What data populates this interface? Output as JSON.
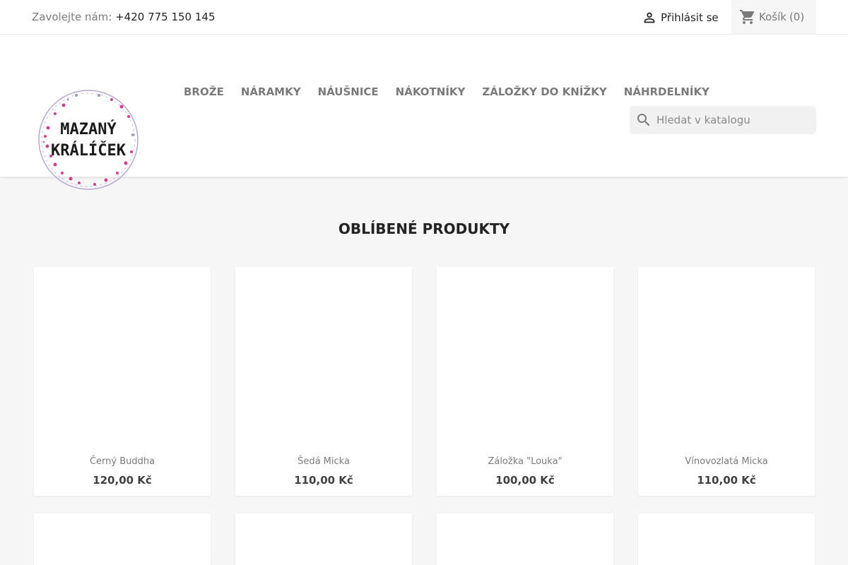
{
  "topbar": {
    "contact_label": "Zavolejte nám:",
    "phone": "+420 775 150 145",
    "signin_label": "Přihlásit se",
    "cart_label": "Košík",
    "cart_count": "(0)"
  },
  "logo": {
    "line1": "MAZANÝ",
    "line2": "KRÁLÍČEK"
  },
  "nav": {
    "items": [
      {
        "label": "BROŽE"
      },
      {
        "label": "NÁRAMKY"
      },
      {
        "label": "NÁUŠNICE"
      },
      {
        "label": "NÁKOTNÍKY"
      },
      {
        "label": "ZÁLOŽKY DO KNÍŽKY"
      },
      {
        "label": "NÁHRDELNÍKY"
      }
    ]
  },
  "search": {
    "placeholder": "Hledat v katalogu",
    "icon": "search-icon"
  },
  "featured": {
    "title": "OBLÍBENÉ PRODUKTY",
    "products": [
      {
        "name": "Černý Buddha",
        "price": "120,00 Kč"
      },
      {
        "name": "Šedá Micka",
        "price": "110,00 Kč"
      },
      {
        "name": "Záložka \"Louka\"",
        "price": "100,00 Kč"
      },
      {
        "name": "Vínovozlatá Micka",
        "price": "110,00 Kč"
      }
    ]
  },
  "colors": {
    "text_dark": "#232323",
    "text_muted": "#7a7a7a",
    "background": "#f6f6f6",
    "search_bg": "#f1f1f1"
  }
}
